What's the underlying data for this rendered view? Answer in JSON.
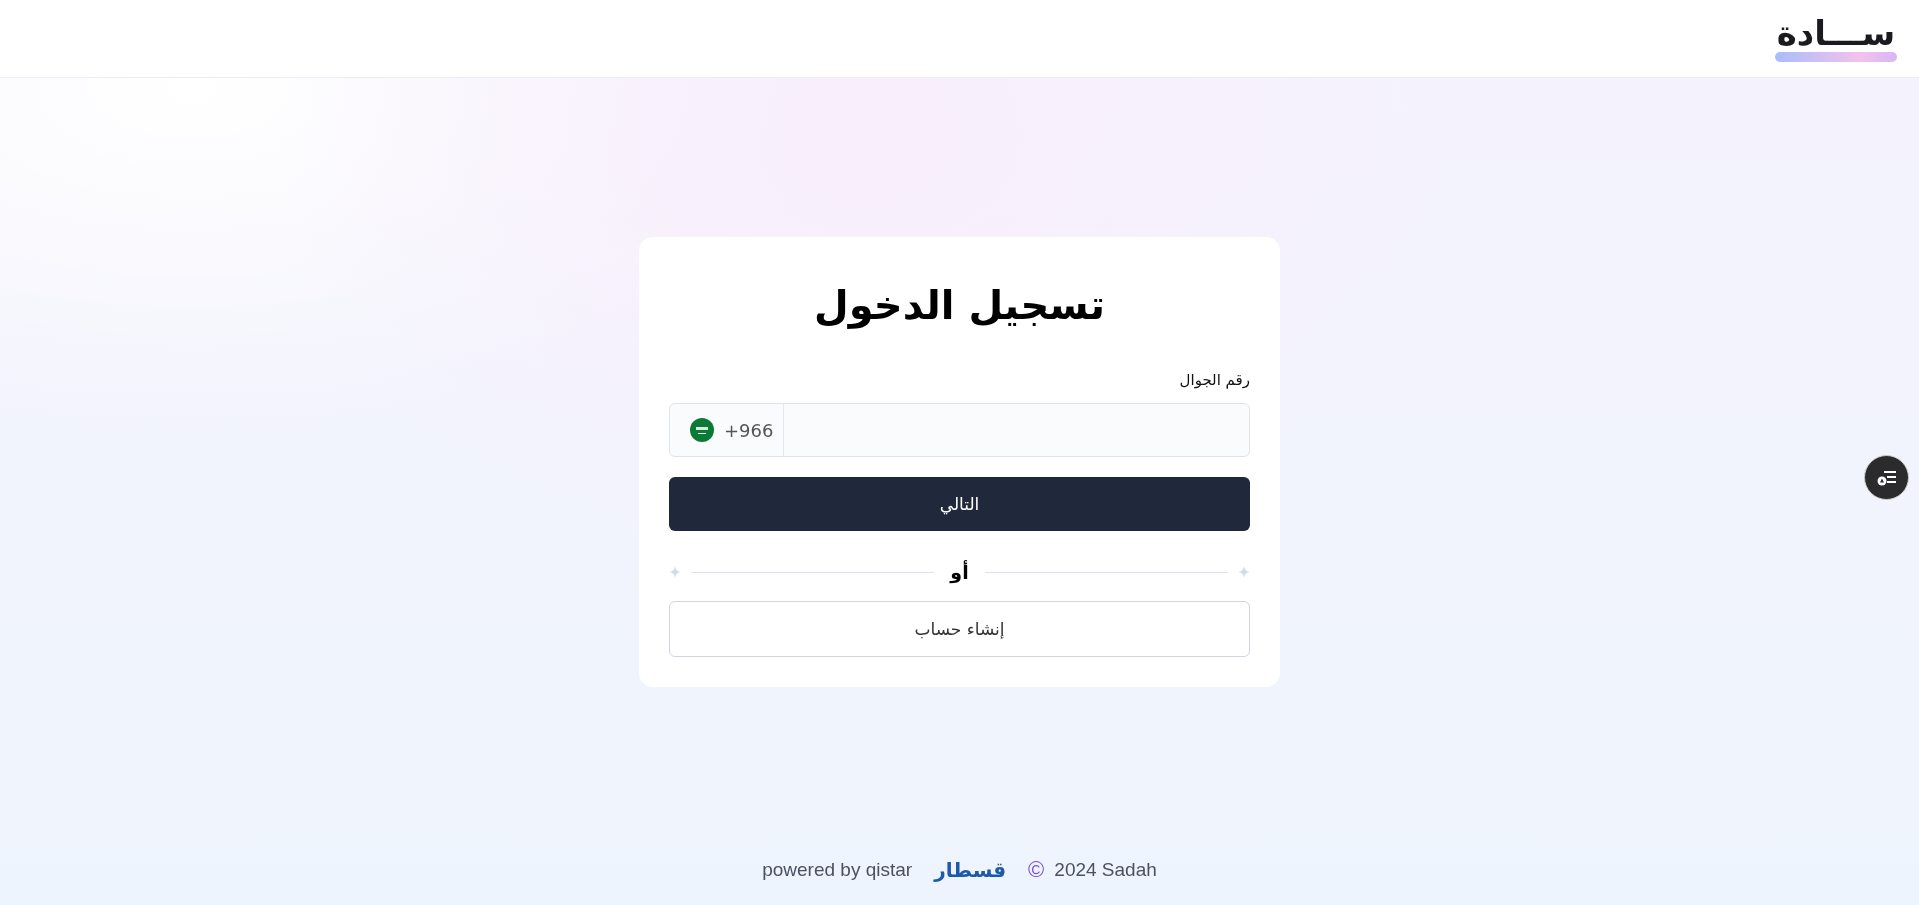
{
  "header": {
    "logo": "ســـادة"
  },
  "login_card": {
    "title": "تسجيل الدخول",
    "phone_label": "رقم الجوال",
    "country_code": "+966",
    "next_button": "التالي",
    "divider_text": "أو",
    "create_account_button": "إنشاء حساب"
  },
  "footer": {
    "powered_by": "powered by qistar",
    "partner_logo": "قسطار",
    "copyright_symbol": "©",
    "copyright": "2024 Sadah"
  }
}
